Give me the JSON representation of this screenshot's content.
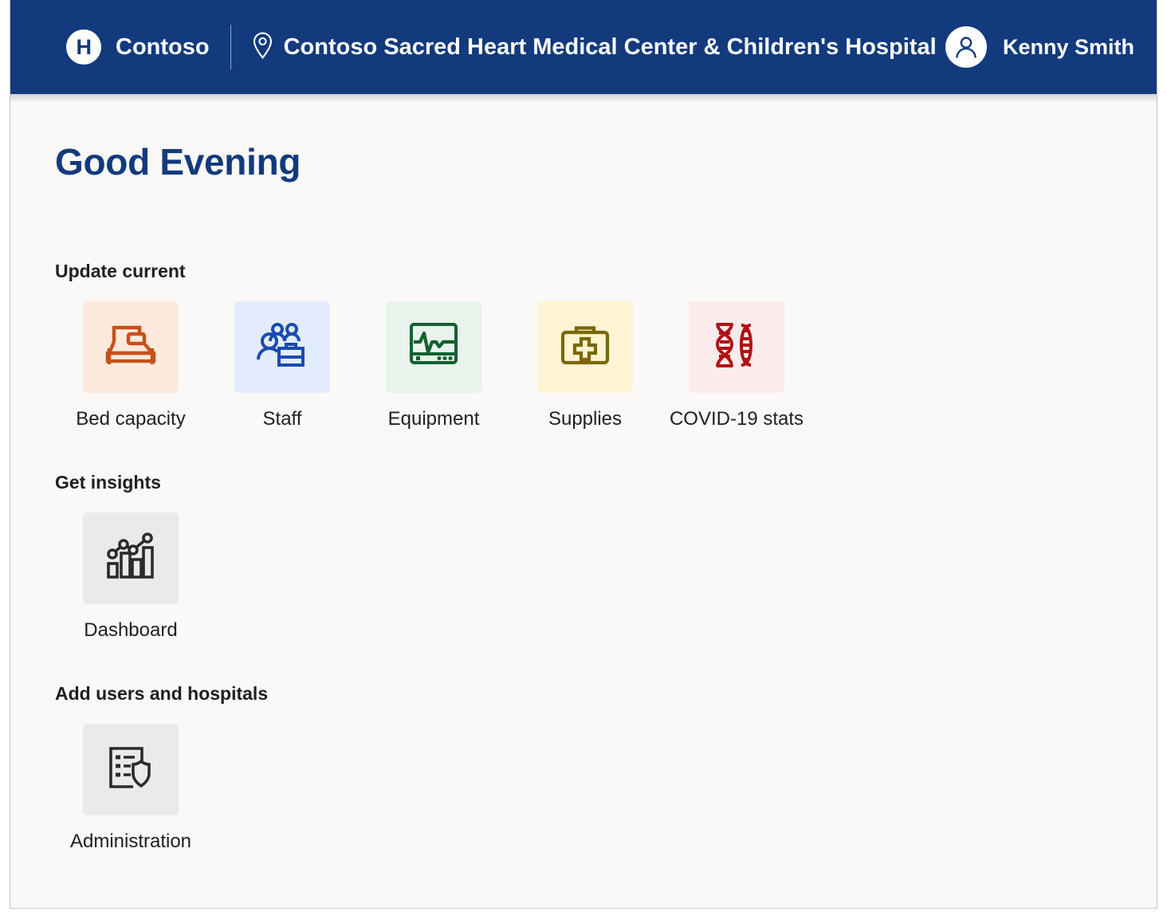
{
  "header": {
    "logo_letter": "H",
    "logo_icon": "hospital-h-logo-icon",
    "brand_name": "Contoso",
    "location_icon": "map-pin-icon",
    "site_name": "Contoso Sacred Heart Medical Center & Children's Hospital",
    "avatar_icon": "person-avatar-icon",
    "user_name": "Kenny Smith",
    "background_color": "#123a7d",
    "text_color": "#ffffff"
  },
  "page": {
    "greeting": "Good Evening",
    "greeting_color": "#123a7d",
    "background_color": "#faf9f8"
  },
  "sections": [
    {
      "title": "Update current",
      "tiles": [
        {
          "label": "Bed capacity",
          "icon": "bed-icon",
          "bg": "#fdeadd",
          "fg": "#c8501a"
        },
        {
          "label": "Staff",
          "icon": "people-briefcase-icon",
          "bg": "#e3ecfc",
          "fg": "#1a4bb0"
        },
        {
          "label": "Equipment",
          "icon": "ekg-monitor-icon",
          "bg": "#e8f3ec",
          "fg": "#126130"
        },
        {
          "label": "Supplies",
          "icon": "first-aid-kit-icon",
          "bg": "#fcf4d2",
          "fg": "#7a6806"
        },
        {
          "label": "COVID-19 stats",
          "icon": "dna-helix-icon",
          "bg": "#fbeceb",
          "fg": "#b01217"
        }
      ]
    },
    {
      "title": "Get insights",
      "tiles": [
        {
          "label": "Dashboard",
          "icon": "bar-chart-trend-icon",
          "bg": "#ebeaea",
          "fg": "#2b2b2b"
        }
      ]
    },
    {
      "title": "Add users and hospitals",
      "tiles": [
        {
          "label": "Administration",
          "icon": "document-shield-icon",
          "bg": "#ebeaea",
          "fg": "#2b2b2b"
        }
      ]
    }
  ]
}
